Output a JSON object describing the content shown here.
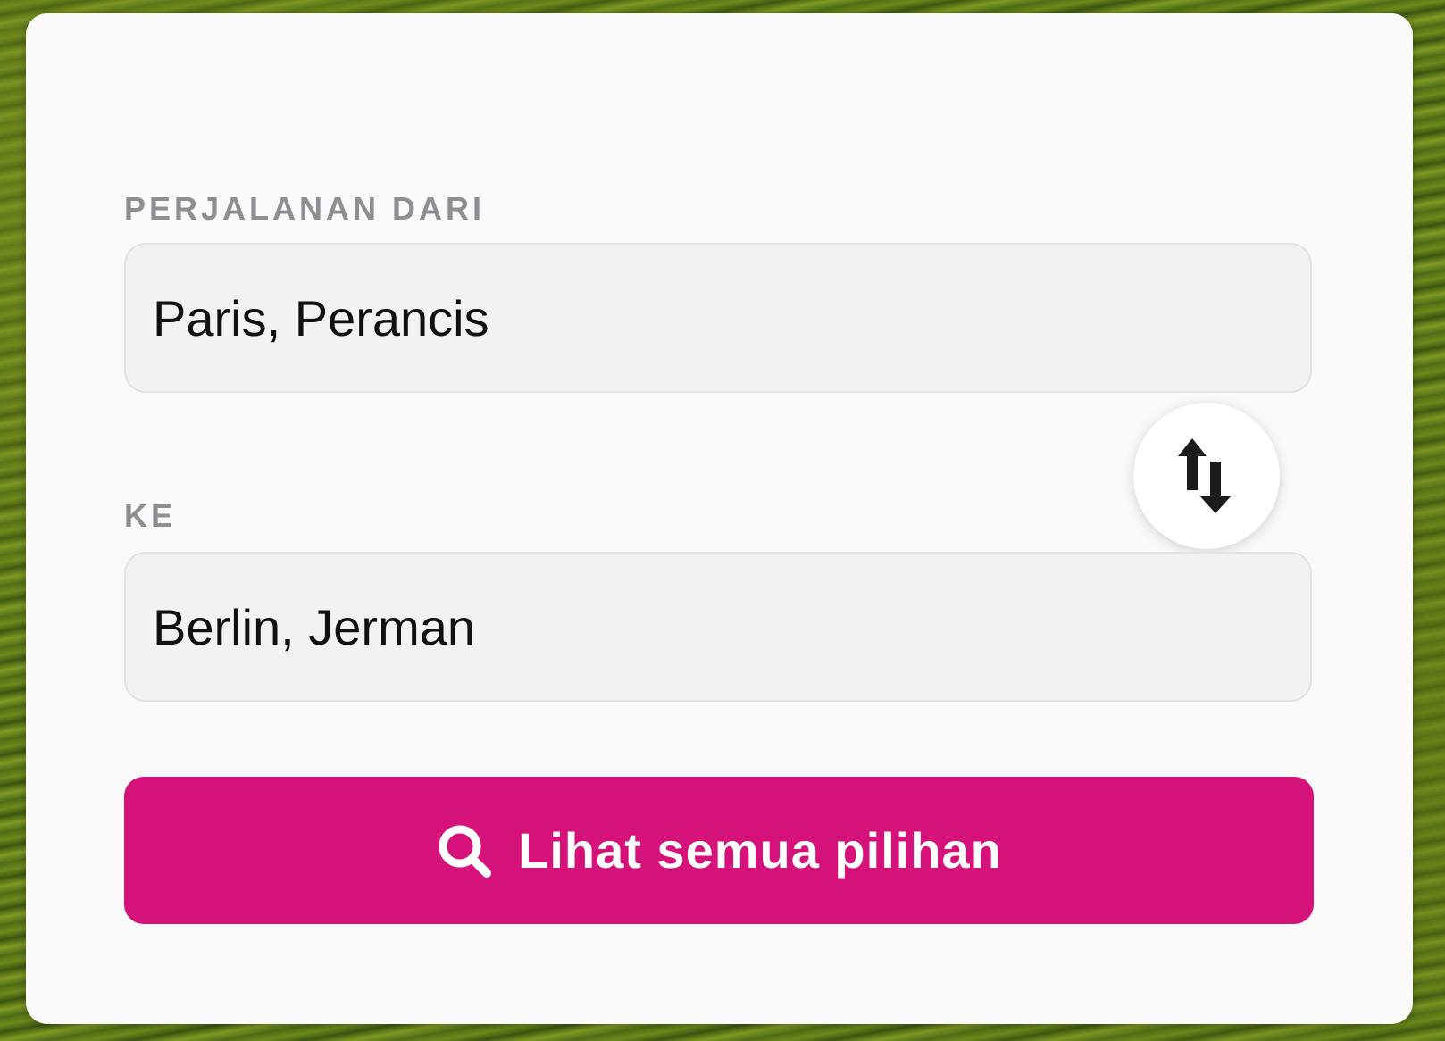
{
  "form": {
    "from_label": "PERJALANAN DARI",
    "from_value": "Paris, Perancis",
    "to_label": "KE",
    "to_value": "Berlin, Jerman",
    "swap_icon": "swap-vertical-arrows",
    "search_icon": "search-magnifier",
    "search_button_label": "Lihat semua pilihan"
  },
  "colors": {
    "accent": "#d4127a",
    "card_background": "#fafafa",
    "input_background": "#f2f2f3",
    "label_text": "#8e8e93",
    "value_text": "#111111"
  }
}
